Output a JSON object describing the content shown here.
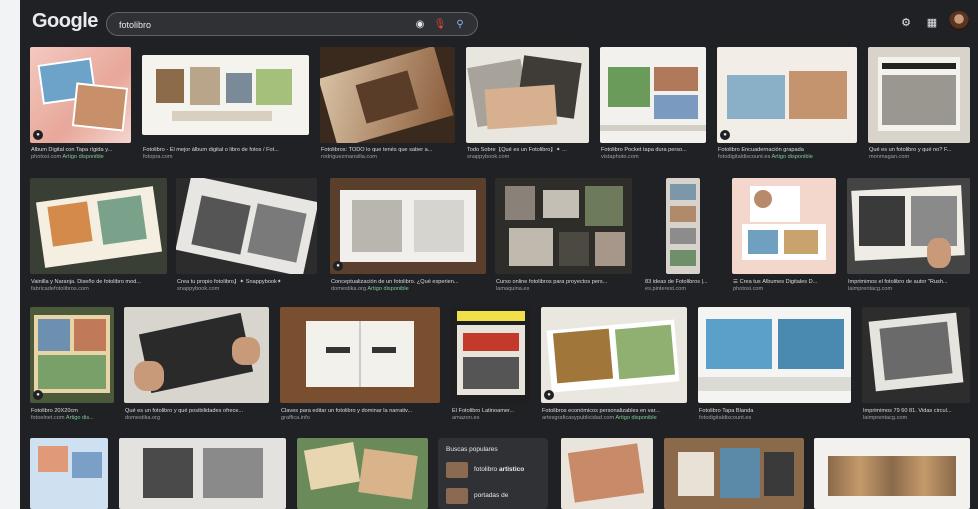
{
  "search": {
    "logo": "Google",
    "query": "fotolibro",
    "camera_icon": "camera-icon",
    "mic_icon": "mic-icon",
    "search_icon": "search-icon"
  },
  "header": {
    "settings_icon": "gear-icon",
    "apps_icon": "apps-grid-icon"
  },
  "results": [
    {
      "title": "Álbum Digital con Tapa rígida y...",
      "source": "photosi.com",
      "avail": "Artigo disponible"
    },
    {
      "title": "Fotolibro - El mejor álbum digital o libro de fotos / Fot...",
      "source": "fotopra.com",
      "avail": ""
    },
    {
      "title": "Fotolibros: TODO lo que tenés que saber a...",
      "source": "rodriguezmansilla.com",
      "avail": ""
    },
    {
      "title": "Todo Sobre【Qué es un Fotolibro】✦ ...",
      "source": "snappybook.com",
      "avail": ""
    },
    {
      "title": "Fotolibro Pocket tapa dura perso...",
      "source": "vistaphoto.com",
      "avail": ""
    },
    {
      "title": "Fotolibro Encuadernación grapada",
      "source": "fotodigitaldiscount.es",
      "avail": "Artigo disponible"
    },
    {
      "title": "Qué es un fotolibro y qué no? F...",
      "source": "monmagan.com",
      "avail": ""
    },
    {
      "title": "Vainilla y Naranja. Diseño de fotolibro mod...",
      "source": "fabricadefotolibros.com",
      "avail": ""
    },
    {
      "title": "Crea tu propio fotolibro】✦ Snappybook✦",
      "source": "snappybook.com",
      "avail": ""
    },
    {
      "title": "Conceptualización de un fotolibro. ¿Qué experien...",
      "source": "domestika.org",
      "avail": "Artigo disponible"
    },
    {
      "title": "Curso online fotolibros para proyectos pers...",
      "source": "lamaquina.es",
      "avail": ""
    },
    {
      "title": "83 ideas de Fotolibros |...",
      "source": "es.pinterest.com",
      "avail": ""
    },
    {
      "title": "☰ Crea tus Álbumes Digitales D...",
      "source": "photosi.com",
      "avail": ""
    },
    {
      "title": "Imprimimos el fotolibro de autor \"Rush...",
      "source": "laimprentacg.com",
      "avail": ""
    },
    {
      "title": "Fotolibro 20X20cm",
      "source": "fotoelnet.com",
      "avail": "Artigo dis..."
    },
    {
      "title": "Qué es un fotolibro y qué posibilidades ofrece...",
      "source": "domestika.org",
      "avail": ""
    },
    {
      "title": "Claves para editar un fotolibro y dominar la narrativ...",
      "source": "graffica.info",
      "avail": ""
    },
    {
      "title": "El Fotolibro Latinoamer...",
      "source": "amazon.es",
      "avail": ""
    },
    {
      "title": "Fotolibros económicos personalizables en var...",
      "source": "artesgraficasypublicidad.com",
      "avail": "Artigo disponible"
    },
    {
      "title": "Fotolibro Tapa Blanda",
      "source": "fotodigitaldiscount.es",
      "avail": ""
    },
    {
      "title": "Imprimimos 79 60 81. Vidas circul...",
      "source": "laimprentacg.com",
      "avail": ""
    }
  ],
  "popular": {
    "title": "Buscas populares",
    "items": [
      {
        "prefix": "fotolibro ",
        "bold": "artistico"
      },
      {
        "prefix": "portadas de",
        "bold": ""
      }
    ]
  }
}
